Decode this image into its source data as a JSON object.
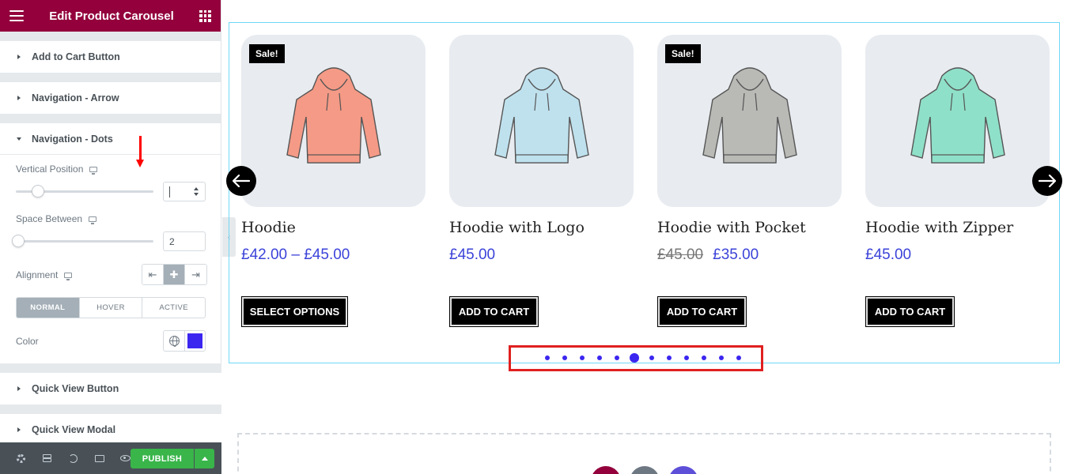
{
  "app": {
    "title": "Edit Product Carousel"
  },
  "sections": {
    "add_to_cart": "Add to Cart Button",
    "nav_arrow": "Navigation - Arrow",
    "nav_dots": "Navigation - Dots",
    "quick_view_button": "Quick View Button",
    "quick_view_modal": "Quick View Modal"
  },
  "controls": {
    "vertical_position": {
      "label": "Vertical Position",
      "value": "",
      "slider_level": 0.16
    },
    "space_between": {
      "label": "Space Between",
      "value": "2",
      "slider_level": 0.0
    },
    "alignment": {
      "label": "Alignment",
      "options": [
        "left",
        "center",
        "right"
      ],
      "selected": "center"
    },
    "state_tabs": [
      "NORMAL",
      "HOVER",
      "ACTIVE"
    ],
    "state_selected": "NORMAL",
    "color": {
      "label": "Color",
      "value": "#3b26f0"
    }
  },
  "footer": {
    "publish_label": "PUBLISH"
  },
  "products": [
    {
      "name": "Hoodie",
      "price": "£42.00 – £45.00",
      "old_price": "",
      "sale": "Sale!",
      "button": "SELECT OPTIONS",
      "hoodie_color": "#f59a86"
    },
    {
      "name": "Hoodie with Logo",
      "price": "£45.00",
      "old_price": "",
      "sale": "",
      "button": "ADD TO CART",
      "hoodie_color": "#bfe1ee"
    },
    {
      "name": "Hoodie with Pocket",
      "price": "£35.00",
      "old_price": "£45.00",
      "sale": "Sale!",
      "button": "ADD TO CART",
      "hoodie_color": "#b9b9b6"
    },
    {
      "name": "Hoodie with Zipper",
      "price": "£45.00",
      "old_price": "",
      "sale": "",
      "button": "ADD TO CART",
      "hoodie_color": "#8fe0c8"
    }
  ],
  "pagination": {
    "total_dots": 12,
    "active_index": 5,
    "dot_color": "#3b26f0"
  },
  "colors": {
    "brand": "#93003c",
    "publish": "#39b54a",
    "price": "#3b43d9",
    "highlight": "#e02020"
  }
}
